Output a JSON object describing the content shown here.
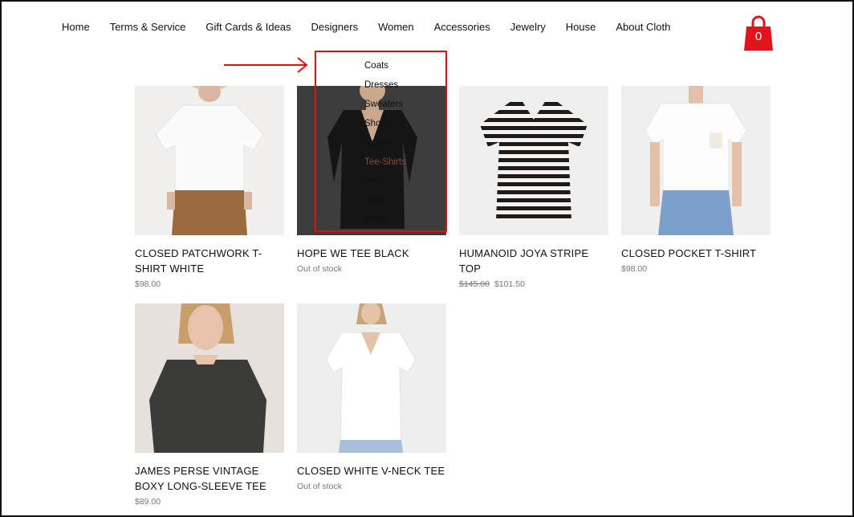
{
  "nav": {
    "items": [
      "Home",
      "Terms & Service",
      "Gift Cards & Ideas",
      "Designers",
      "Women",
      "Accessories",
      "Jewelry",
      "House",
      "About Cloth"
    ]
  },
  "cart": {
    "count": "0",
    "icon": "shopping-bag-icon",
    "color": "#e3131b"
  },
  "dropdown": {
    "items": [
      "Coats",
      "Dresses",
      "Sweaters",
      "Shorts",
      "Jackets",
      "Tee-Shirts",
      "Tops",
      "Skirts",
      "Pants"
    ],
    "active": "Tee-Shirts"
  },
  "products": [
    {
      "name": "CLOSED PATCHWORK T-SHIRT WHITE",
      "price": "$98.00"
    },
    {
      "name": "HOPE WE TEE BLACK",
      "status": "Out of stock"
    },
    {
      "name": "HUMANOID JOYA STRIPE TOP",
      "old_price": "$145.00",
      "price": "$101.50"
    },
    {
      "name": "CLOSED POCKET T-SHIRT",
      "price": "$98.00"
    },
    {
      "name": "JAMES PERSE VINTAGE BOXY LONG-SLEEVE TEE",
      "price": "$89.00"
    },
    {
      "name": "CLOSED WHITE V-NECK TEE",
      "status": "Out of stock"
    }
  ],
  "colors": {
    "annotation": "#e01010",
    "accent": "#e3131b"
  }
}
